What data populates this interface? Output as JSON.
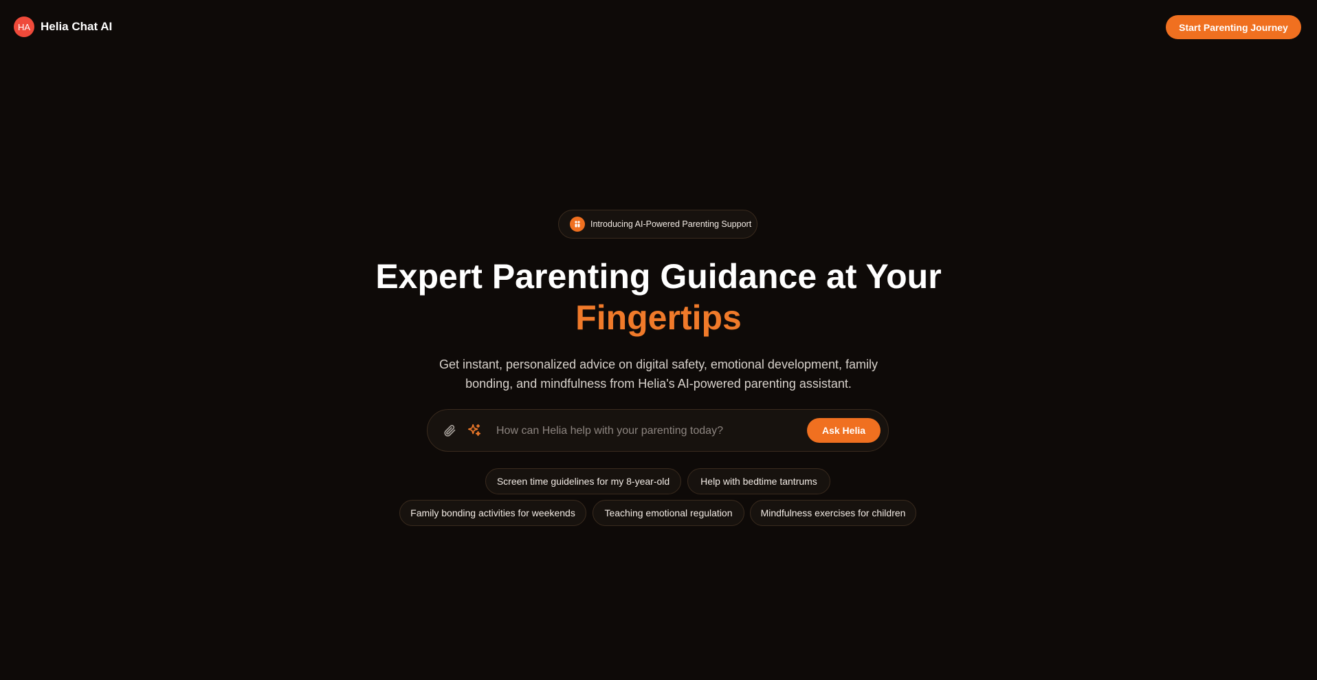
{
  "header": {
    "logo_initials": "HA",
    "brand": "Helia Chat AI",
    "cta_label": "Start Parenting Journey"
  },
  "hero": {
    "badge_text": "Introducing AI-Powered Parenting Support",
    "title_line1": "Expert Parenting Guidance at Your",
    "title_line2": "Fingertips",
    "subtitle": "Get instant, personalized advice on digital safety, emotional development, family bonding, and mindfulness from Helia's AI-powered parenting assistant."
  },
  "search": {
    "placeholder": "How can Helia help with your parenting today?",
    "value": "",
    "submit_label": "Ask Helia"
  },
  "suggestions": [
    {
      "label": "Screen time guidelines for my 8-year-old"
    },
    {
      "label": "Help with bedtime tantrums"
    },
    {
      "label": "Family bonding activities for weekends"
    },
    {
      "label": "Teaching emotional regulation"
    },
    {
      "label": "Mindfulness exercises for children"
    }
  ],
  "icons": {
    "attach": "paperclip-icon",
    "magic": "sparkles-icon",
    "badge": "family-icon"
  },
  "colors": {
    "background": "#0e0a08",
    "accent": "#f07020",
    "accent_text": "#f07a2a",
    "logo": "#ef4a3a",
    "border": "#3a2b1e",
    "surface": "#17120e"
  }
}
